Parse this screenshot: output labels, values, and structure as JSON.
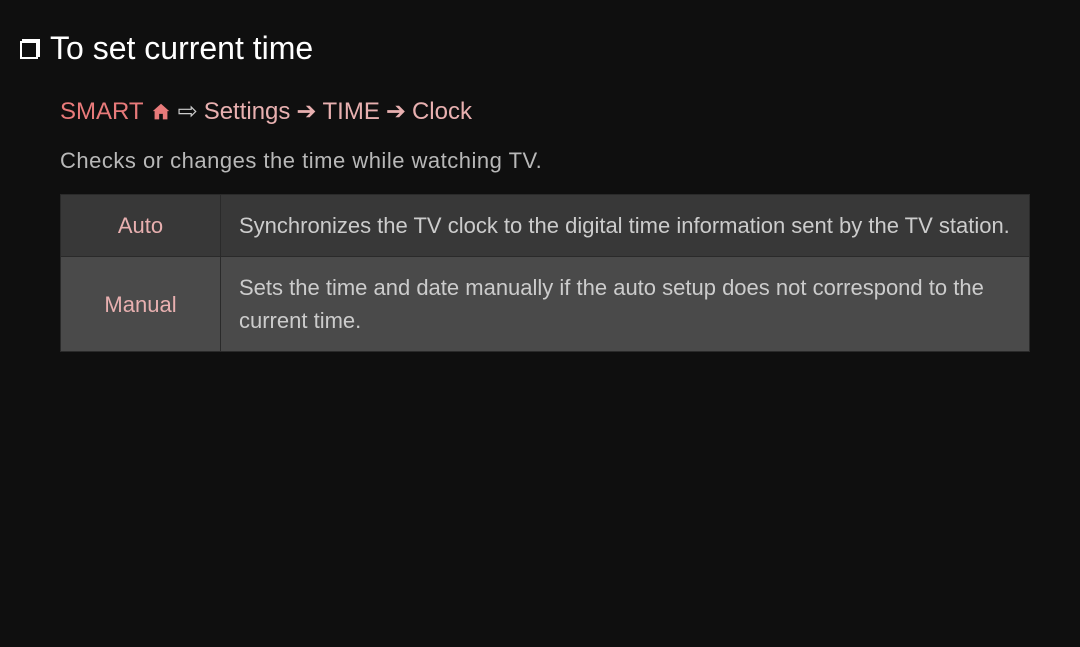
{
  "title": "To set current time",
  "breadcrumb": {
    "smart": "SMART",
    "settings": "Settings",
    "time": "TIME",
    "clock": "Clock"
  },
  "description": "Checks or changes the time while watching TV.",
  "table": {
    "rows": [
      {
        "label": "Auto",
        "desc": "Synchronizes the TV clock to the digital time information sent by the TV station."
      },
      {
        "label": "Manual",
        "desc": "Sets the time and date manually if the auto setup does not correspond to the current time."
      }
    ]
  }
}
